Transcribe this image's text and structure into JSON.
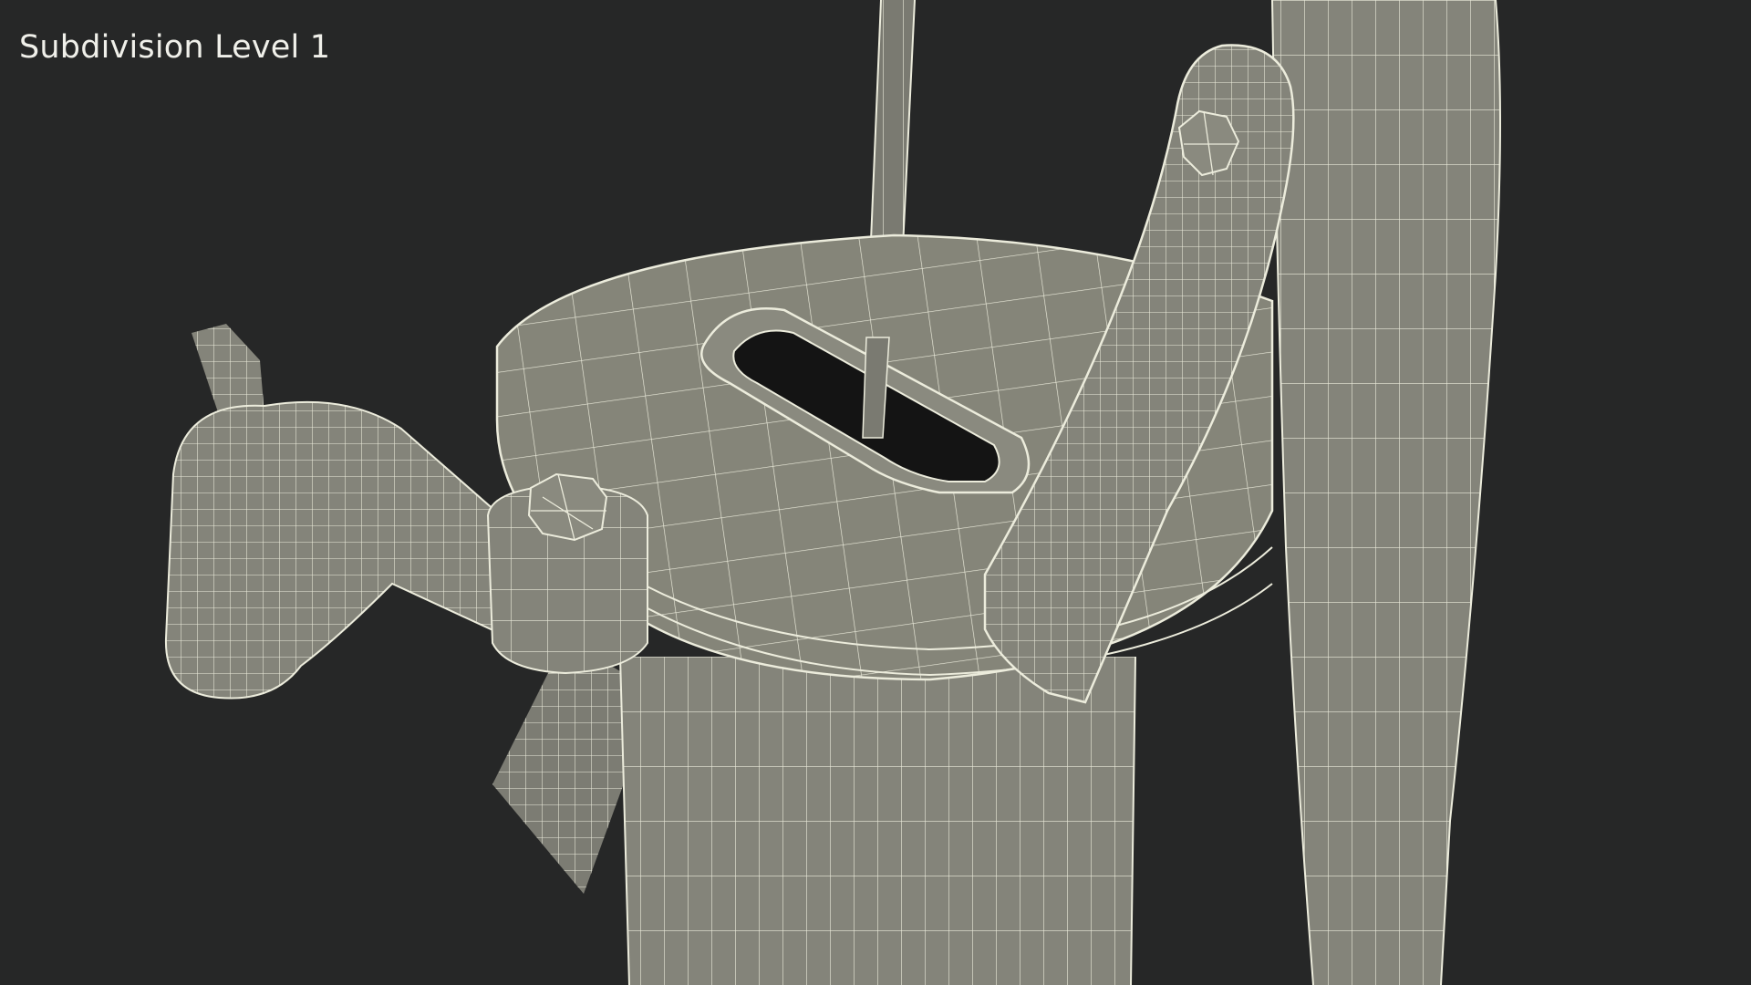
{
  "viewport": {
    "caption": "Subdivision Level 1",
    "background_color": "#262727",
    "mesh_fill_color": "#84847a",
    "mesh_shadow_color": "#6a6a61",
    "wire_color": "#ececdc",
    "cavity_color": "#141414"
  }
}
